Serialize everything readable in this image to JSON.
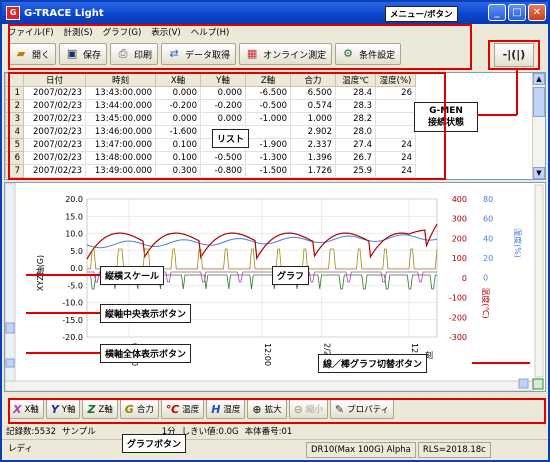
{
  "window": {
    "title": "G-TRACE Light",
    "min": "_",
    "max": "□",
    "close": "✕"
  },
  "menu": [
    "ファイル(F)",
    "計測(S)",
    "グラフ(G)",
    "表示(V)",
    "ヘルプ(H)"
  ],
  "toolbar": [
    {
      "label": "開く",
      "icon": "open-icon"
    },
    {
      "label": "保存",
      "icon": "save-icon"
    },
    {
      "label": "印刷",
      "icon": "print-icon"
    },
    {
      "label": "データ取得",
      "icon": "download-icon"
    },
    {
      "label": "オンライン測定",
      "icon": "online-measure-icon"
    },
    {
      "label": "条件設定",
      "icon": "settings-icon"
    }
  ],
  "gmen_status": "-|(|)",
  "table": {
    "headers": [
      "",
      "日付",
      "時刻",
      "X軸",
      "Y軸",
      "Z軸",
      "合力",
      "温度℃",
      "湿度(%)"
    ],
    "rows": [
      [
        "1",
        "2007/02/23",
        "13:43:00.000",
        "0.000",
        "0.000",
        "-6.500",
        "6.500",
        "28.4",
        "26"
      ],
      [
        "2",
        "2007/02/23",
        "13:44:00.000",
        "-0.200",
        "-0.200",
        "-0.500",
        "0.574",
        "28.3",
        ""
      ],
      [
        "3",
        "2007/02/23",
        "13:45:00.000",
        "0.000",
        "0.000",
        "-1.000",
        "1.000",
        "28.2",
        ""
      ],
      [
        "4",
        "2007/02/23",
        "13:46:00.000",
        "-1.600",
        "",
        "",
        "2.902",
        "28.0",
        ""
      ],
      [
        "5",
        "2007/02/23",
        "13:47:00.000",
        "0.100",
        "-1.000",
        "-1.900",
        "2.337",
        "27.4",
        "24"
      ],
      [
        "6",
        "2007/02/23",
        "13:48:00.000",
        "0.100",
        "-0.500",
        "-1.300",
        "1.396",
        "26.7",
        "24"
      ],
      [
        "7",
        "2007/02/23",
        "13:49:00.000",
        "0.300",
        "-0.800",
        "-1.500",
        "1.726",
        "25.9",
        "24"
      ]
    ]
  },
  "graph": {
    "left_axis_label": "XYZ軸(G)",
    "right_axis_label1": "温度(℃)",
    "right_axis_label2": "湿度(%)",
    "left_ticks": [
      "20.0",
      "15.0",
      "10.0",
      "5.0",
      "0.0",
      "-5.0",
      "-10.0",
      "-15.0",
      "-20.0"
    ],
    "right_ticks1": [
      "400",
      "300",
      "200",
      "100",
      "0",
      "-100",
      "-200",
      "-300"
    ],
    "right_ticks2": [
      "80",
      "60",
      "40",
      "20",
      "0"
    ],
    "x_ticks": [
      "00:00",
      "12:00",
      "2/26",
      "12:00"
    ],
    "x_extra": "刻"
  },
  "graph_buttons": [
    {
      "icon": "X",
      "label": "X軸",
      "color": "#b040c0",
      "disabled": false
    },
    {
      "icon": "Y",
      "label": "Y軸",
      "color": "#203090",
      "disabled": false
    },
    {
      "icon": "Z",
      "label": "Z軸",
      "color": "#107030",
      "disabled": false
    },
    {
      "icon": "G",
      "label": "合力",
      "color": "#a08000",
      "disabled": false
    },
    {
      "icon": "℃",
      "label": "温度",
      "color": "#c00000",
      "disabled": false
    },
    {
      "icon": "H",
      "label": "湿度",
      "color": "#2050c0",
      "disabled": false
    },
    {
      "icon": "⊕",
      "label": "拡大",
      "color": "#333333",
      "disabled": false
    },
    {
      "icon": "⊖",
      "label": "縮小",
      "color": "#a8a690",
      "disabled": true
    },
    {
      "icon": "✎",
      "label": "プロパティ",
      "color": "#333333",
      "disabled": false
    }
  ],
  "info": {
    "records": "記録数:5532",
    "sampling": "サンプル",
    "interval": "1分",
    "threshold": "しきい値:0.0G",
    "body": "本体番号:01"
  },
  "status": {
    "ready": "レディ",
    "device": "DR10(Max 100G) Alpha",
    "rls": "RLS=2018.18c"
  },
  "annotations": {
    "menu_button": "メニュー/ボタン",
    "gmen": "G-MEN\n接続状態",
    "list": "リスト",
    "scale": "縦横スケール",
    "graph": "グラフ",
    "v_center": "縦軸中央表示ボタン",
    "h_all": "横軸全体表示ボタン",
    "line_bar": "線／棒グラフ切替ボタン",
    "graph_button": "グラフボタン"
  },
  "colors": {
    "annotation_red": "#e00000",
    "temp": "#b00000",
    "humidity": "#4a7fd8",
    "x": "#b040c0",
    "z": "#2a7a2a",
    "g": "#a08a10"
  }
}
